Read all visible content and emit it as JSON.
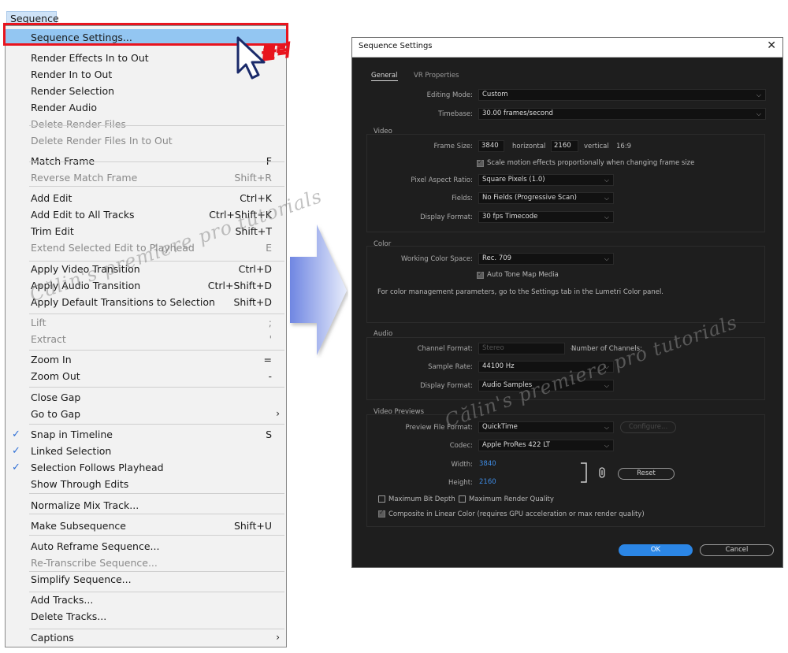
{
  "menu": {
    "title": "Sequence",
    "items": [
      {
        "label": "Sequence Settings...",
        "shortcut": "",
        "disabled": false,
        "checked": false,
        "submenu": false
      },
      {
        "label": "Render Effects In to Out",
        "shortcut": "",
        "disabled": false
      },
      {
        "label": "Render In to Out",
        "shortcut": "",
        "disabled": false
      },
      {
        "label": "Render Selection",
        "shortcut": "",
        "disabled": false
      },
      {
        "label": "Render Audio",
        "shortcut": "",
        "disabled": false
      },
      {
        "label": "Delete Render Files",
        "shortcut": "",
        "disabled": true
      },
      {
        "label": "Delete Render Files In to Out",
        "shortcut": "",
        "disabled": true
      },
      {
        "label": "Match Frame",
        "shortcut": "F",
        "disabled": false
      },
      {
        "label": "Reverse Match Frame",
        "shortcut": "Shift+R",
        "disabled": true
      },
      {
        "label": "Add Edit",
        "shortcut": "Ctrl+K",
        "disabled": false
      },
      {
        "label": "Add Edit to All Tracks",
        "shortcut": "Ctrl+Shift+K",
        "disabled": false
      },
      {
        "label": "Trim Edit",
        "shortcut": "Shift+T",
        "disabled": false
      },
      {
        "label": "Extend Selected Edit to Playhead",
        "shortcut": "E",
        "disabled": true
      },
      {
        "label": "Apply Video Transition",
        "shortcut": "Ctrl+D",
        "disabled": false
      },
      {
        "label": "Apply Audio Transition",
        "shortcut": "Ctrl+Shift+D",
        "disabled": false
      },
      {
        "label": "Apply Default Transitions to Selection",
        "shortcut": "Shift+D",
        "disabled": false
      },
      {
        "label": "Lift",
        "shortcut": ";",
        "disabled": true
      },
      {
        "label": "Extract",
        "shortcut": "'",
        "disabled": true
      },
      {
        "label": "Zoom In",
        "shortcut": "=",
        "disabled": false
      },
      {
        "label": "Zoom Out",
        "shortcut": "-",
        "disabled": false
      },
      {
        "label": "Close Gap",
        "shortcut": "",
        "disabled": false
      },
      {
        "label": "Go to Gap",
        "shortcut": "",
        "disabled": false,
        "submenu": true
      },
      {
        "label": "Snap in Timeline",
        "shortcut": "S",
        "disabled": false,
        "checked": true
      },
      {
        "label": "Linked Selection",
        "shortcut": "",
        "disabled": false,
        "checked": true
      },
      {
        "label": "Selection Follows Playhead",
        "shortcut": "",
        "disabled": false,
        "checked": true
      },
      {
        "label": "Show Through Edits",
        "shortcut": "",
        "disabled": false
      },
      {
        "label": "Normalize Mix Track...",
        "shortcut": "",
        "disabled": false
      },
      {
        "label": "Make Subsequence",
        "shortcut": "Shift+U",
        "disabled": false
      },
      {
        "label": "Auto Reframe Sequence...",
        "shortcut": "",
        "disabled": false
      },
      {
        "label": "Re-Transcribe Sequence...",
        "shortcut": "",
        "disabled": true
      },
      {
        "label": "Simplify Sequence...",
        "shortcut": "",
        "disabled": false
      },
      {
        "label": "Add Tracks...",
        "shortcut": "",
        "disabled": false
      },
      {
        "label": "Delete Tracks...",
        "shortcut": "",
        "disabled": false
      },
      {
        "label": "Captions",
        "shortcut": "",
        "disabled": false,
        "submenu": true
      }
    ],
    "checkmark": "✓",
    "submenu_arrow": "›"
  },
  "annotation": {
    "click_label": "클릭",
    "highlight_color": "#e8141e",
    "arrow_color": "#7f93e6"
  },
  "watermark": "Călin's premiere pro tutorials",
  "dialog": {
    "title": "Sequence Settings",
    "close": "✕",
    "tabs": [
      "General",
      "VR Properties"
    ],
    "editing_mode_label": "Editing Mode:",
    "editing_mode": "Custom",
    "timebase_label": "Timebase:",
    "timebase": "30.00  frames/second",
    "video": {
      "title": "Video",
      "frame_size_label": "Frame Size:",
      "width": "3840",
      "horizontal": "horizontal",
      "height": "2160",
      "vertical": "vertical",
      "ratio": "16:9",
      "scale_motion": "Scale motion effects proportionally when changing frame size",
      "pixel_aspect_label": "Pixel Aspect Ratio:",
      "pixel_aspect": "Square Pixels (1.0)",
      "fields_label": "Fields:",
      "fields": "No Fields (Progressive Scan)",
      "display_format_label": "Display Format:",
      "display_format": "30 fps Timecode"
    },
    "color": {
      "title": "Color",
      "working_space_label": "Working Color Space:",
      "working_space": "Rec. 709",
      "auto_tone": "Auto Tone Map Media",
      "note": "For color management parameters, go to the Settings tab in the Lumetri Color panel."
    },
    "audio": {
      "title": "Audio",
      "channel_format_label": "Channel Format:",
      "channel_format": "Stereo",
      "num_channels_label": "Number of Channels:",
      "sample_rate_label": "Sample Rate:",
      "sample_rate": "44100 Hz",
      "display_format_label": "Display Format:",
      "display_format": "Audio Samples"
    },
    "previews": {
      "title": "Video Previews",
      "file_format_label": "Preview File Format:",
      "file_format": "QuickTime",
      "configure": "Configure...",
      "codec_label": "Codec:",
      "codec": "Apple ProRes 422 LT",
      "width_label": "Width:",
      "width": "3840",
      "height_label": "Height:",
      "height": "2160",
      "reset": "Reset",
      "max_bit_depth": "Maximum Bit Depth",
      "max_render_quality": "Maximum Render Quality",
      "composite_linear": "Composite in Linear Color (requires GPU acceleration or max render quality)"
    },
    "ok": "OK",
    "cancel": "Cancel"
  }
}
